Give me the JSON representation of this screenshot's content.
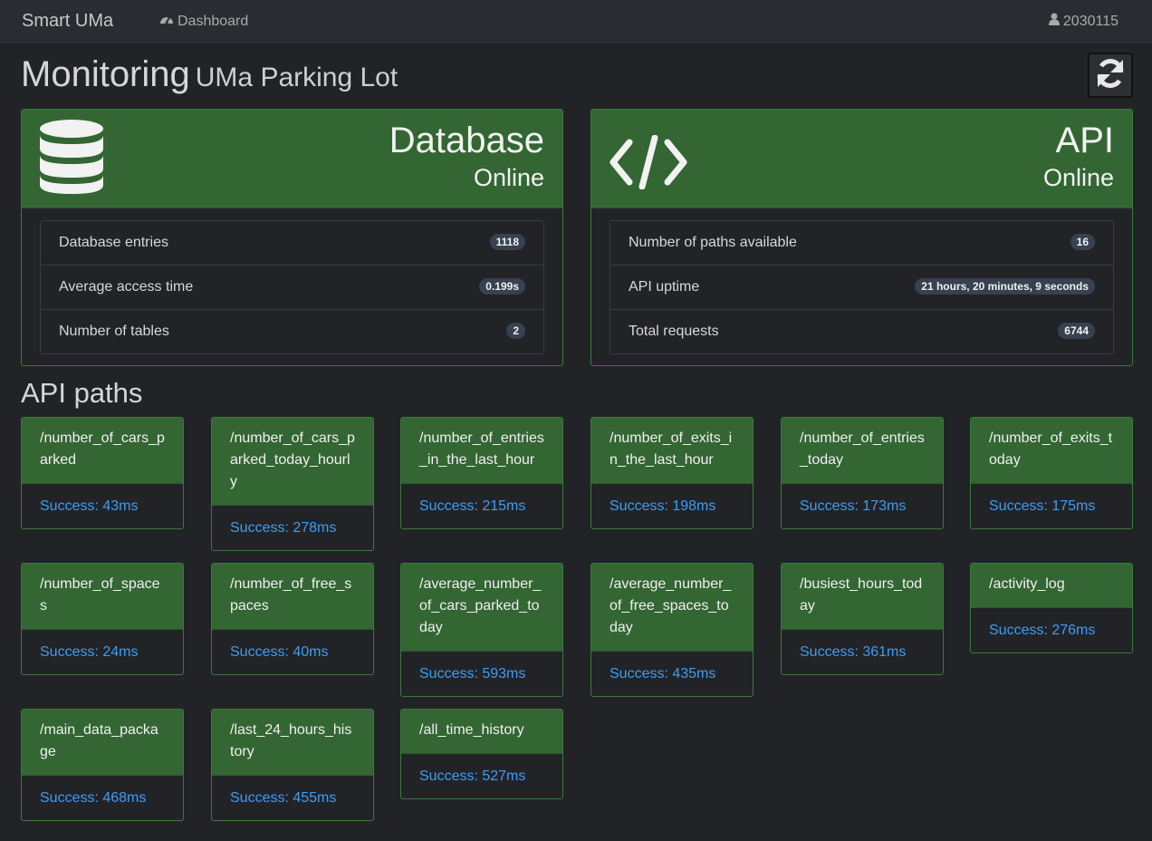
{
  "navbar": {
    "brand": "Smart UMa",
    "dashboard_label": "Dashboard",
    "user_label": "2030115"
  },
  "page": {
    "title": "Monitoring",
    "subtitle": "UMa Parking Lot",
    "section_title": "API paths"
  },
  "colors": {
    "panel_green": "#336633",
    "success_text": "#3d9df2",
    "background": "#222327"
  },
  "database": {
    "icon": "database-icon",
    "title": "Database",
    "status": "Online",
    "rows": [
      {
        "label": "Database entries",
        "value": "1118"
      },
      {
        "label": "Average access time",
        "value": "0.199s"
      },
      {
        "label": "Number of tables",
        "value": "2"
      }
    ]
  },
  "api": {
    "icon": "code-icon",
    "title": "API",
    "status": "Online",
    "rows": [
      {
        "label": "Number of paths available",
        "value": "16"
      },
      {
        "label": "API uptime",
        "value": "21 hours, 20 minutes, 9 seconds"
      },
      {
        "label": "Total requests",
        "value": "6744"
      }
    ]
  },
  "paths": [
    {
      "path": "/number_of_cars_parked",
      "status": "Success: 43ms"
    },
    {
      "path": "/number_of_cars_parked_today_hourly",
      "status": "Success: 278ms"
    },
    {
      "path": "/number_of_entries_in_the_last_hour",
      "status": "Success: 215ms"
    },
    {
      "path": "/number_of_exits_in_the_last_hour",
      "status": "Success: 198ms"
    },
    {
      "path": "/number_of_entries_today",
      "status": "Success: 173ms"
    },
    {
      "path": "/number_of_exits_today",
      "status": "Success: 175ms"
    },
    {
      "path": "/number_of_spaces",
      "status": "Success: 24ms"
    },
    {
      "path": "/number_of_free_spaces",
      "status": "Success: 40ms"
    },
    {
      "path": "/average_number_of_cars_parked_today",
      "status": "Success: 593ms"
    },
    {
      "path": "/average_number_of_free_spaces_today",
      "status": "Success: 435ms"
    },
    {
      "path": "/busiest_hours_today",
      "status": "Success: 361ms"
    },
    {
      "path": "/activity_log",
      "status": "Success: 276ms"
    },
    {
      "path": "/main_data_package",
      "status": "Success: 468ms"
    },
    {
      "path": "/last_24_hours_history",
      "status": "Success: 455ms"
    },
    {
      "path": "/all_time_history",
      "status": "Success: 527ms"
    }
  ]
}
